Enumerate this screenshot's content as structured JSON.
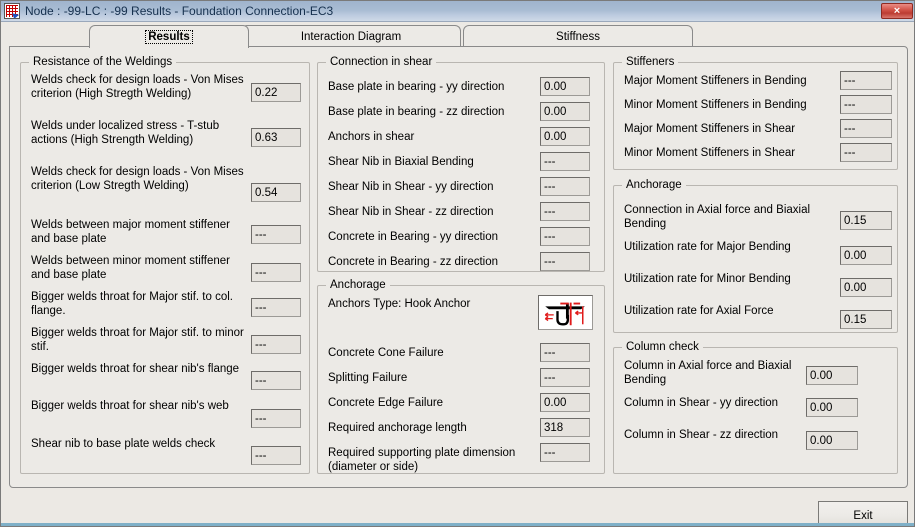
{
  "window": {
    "title": "Node : -99-LC : -99 Results - Foundation Connection-EC3",
    "icon": "spreadsheet-icon",
    "close_label": "×"
  },
  "tabs": [
    {
      "label": "Results",
      "active": true
    },
    {
      "label": "Interaction Diagram",
      "active": false
    },
    {
      "label": "Stiffness",
      "active": false
    }
  ],
  "groups": {
    "resistance_of_weldings": {
      "title": "Resistance of the Weldings",
      "rows": [
        {
          "label": "Welds check for design loads - Von Mises\ncriterion (High Stregth Welding)",
          "value": "0.22"
        },
        {
          "label": "Welds under localized stress - T-stub\nactions (High Strength Welding)",
          "value": "0.63"
        },
        {
          "label": "Welds check for design loads - Von Mises\ncriterion (Low Stregth Welding)",
          "value": "0.54"
        },
        {
          "label": "Welds between major moment stiffener\nand base plate",
          "value": "---"
        },
        {
          "label": "Welds between minor moment stiffener\nand base plate",
          "value": "---"
        },
        {
          "label": "Bigger welds throat for Major stif. to col.\nflange.",
          "value": "---"
        },
        {
          "label": "Bigger welds throat for Major stif. to minor\nstif.",
          "value": "---"
        },
        {
          "label": "Bigger welds throat for shear nib's flange",
          "value": "---"
        },
        {
          "label": "Bigger welds throat for shear nib's web",
          "value": "---"
        },
        {
          "label": "Shear nib to base plate welds check",
          "value": "---"
        }
      ]
    },
    "connection_in_shear": {
      "title": "Connection in shear",
      "rows": [
        {
          "label": "Base plate in bearing - yy direction",
          "value": "0.00"
        },
        {
          "label": "Base plate in bearing - zz direction",
          "value": "0.00"
        },
        {
          "label": "Anchors in shear",
          "value": "0.00"
        },
        {
          "label": "Shear Nib in Biaxial Bending",
          "value": "---"
        },
        {
          "label": "Shear Nib in Shear - yy direction",
          "value": "---"
        },
        {
          "label": "Shear Nib in Shear - zz direction",
          "value": "---"
        },
        {
          "label": "Concrete in Bearing - yy direction",
          "value": "---"
        },
        {
          "label": "Concrete in Bearing - zz direction",
          "value": "---"
        }
      ]
    },
    "anchorage_mid": {
      "title": "Anchorage",
      "anchor_type_label": "Anchors Type: Hook Anchor",
      "anchor_image_name": "hook-anchor-diagram",
      "rows": [
        {
          "label": "Concrete Cone Failure",
          "value": "---"
        },
        {
          "label": "Splitting Failure",
          "value": "---"
        },
        {
          "label": "Concrete Edge Failure",
          "value": "0.00"
        },
        {
          "label": "Required anchorage length",
          "value": "318"
        },
        {
          "label": "Required supporting plate dimension\n(diameter or side)",
          "value": "---"
        }
      ]
    },
    "stiffeners": {
      "title": "Stiffeners",
      "rows": [
        {
          "label": "Major Moment Stiffeners in Bending",
          "value": "---"
        },
        {
          "label": "Minor Moment Stiffeners in Bending",
          "value": "---"
        },
        {
          "label": "Major Moment Stiffeners in Shear",
          "value": "---"
        },
        {
          "label": "Minor Moment Stiffeners in Shear",
          "value": "---"
        }
      ]
    },
    "anchorage_right": {
      "title": "Anchorage",
      "rows": [
        {
          "label": "Connection in Axial force and Biaxial\nBending",
          "value": "0.15"
        },
        {
          "label": "Utilization rate for Major Bending",
          "value": "0.00"
        },
        {
          "label": "Utilization rate for Minor Bending",
          "value": "0.00"
        },
        {
          "label": "Utilization rate for Axial Force",
          "value": "0.15"
        }
      ]
    },
    "column_check": {
      "title": "Column check",
      "rows": [
        {
          "label": "Column in Axial force and Biaxial\nBending",
          "value": "0.00"
        },
        {
          "label": "Column in Shear - yy direction",
          "value": "0.00"
        },
        {
          "label": "Column in Shear - zz direction",
          "value": "0.00"
        }
      ]
    }
  },
  "footer": {
    "exit_label": "Exit"
  },
  "colors": {
    "titlebar_start": "#9fb4cd",
    "titlebar_end": "#cfd9e7",
    "close_red": "#c44338",
    "face": "#eceae6",
    "field": "#e6e3de",
    "accent_strip": "#7fb0c8",
    "diagram_red": "#e01b1b"
  }
}
